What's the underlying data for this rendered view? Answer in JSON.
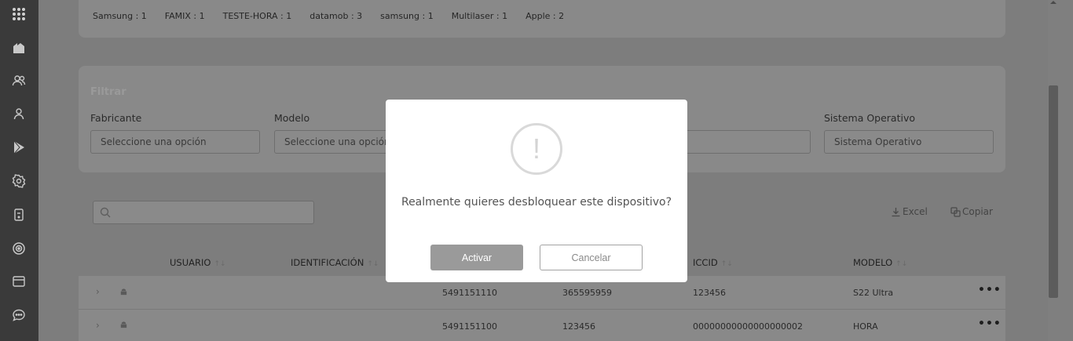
{
  "sidebar": {
    "icons": [
      "apps-grid-icon",
      "home-icon",
      "users-icon",
      "user-icon",
      "play-store-icon",
      "settings-icon",
      "device-icon",
      "target-icon",
      "browser-icon",
      "chat-icon"
    ]
  },
  "brand_counts": [
    "Samsung : 1",
    "FAMIX : 1",
    "TESTE-HORA : 1",
    "datamob : 3",
    "samsung : 1",
    "Multilaser : 1",
    "Apple : 2"
  ],
  "filter": {
    "title": "Filtrar",
    "fabricante_label": "Fabricante",
    "fabricante_value": "Seleccione una opción",
    "modelo_label": "Modelo",
    "modelo_value": "Seleccione una opción",
    "so_label": "Sistema Operativo",
    "so_placeholder": "Sistema Operativo"
  },
  "toolbar": {
    "excel": "Excel",
    "copiar": "Copiar"
  },
  "table": {
    "headers": {
      "usuario": "USUARIO",
      "identificacion": "IDENTIFICACIÓN",
      "iccid": "ICCID",
      "modelo": "MODELO"
    },
    "rows": [
      {
        "phone": "5491151110",
        "imei": "365595959",
        "iccid": "123456",
        "modelo": "S22 Ultra"
      },
      {
        "phone": "5491151100",
        "imei": "123456",
        "iccid": "00000000000000000002",
        "modelo": "HORA"
      }
    ]
  },
  "modal": {
    "message": "Realmente quieres desbloquear este dispositivo?",
    "confirm": "Activar",
    "cancel": "Cancelar"
  }
}
